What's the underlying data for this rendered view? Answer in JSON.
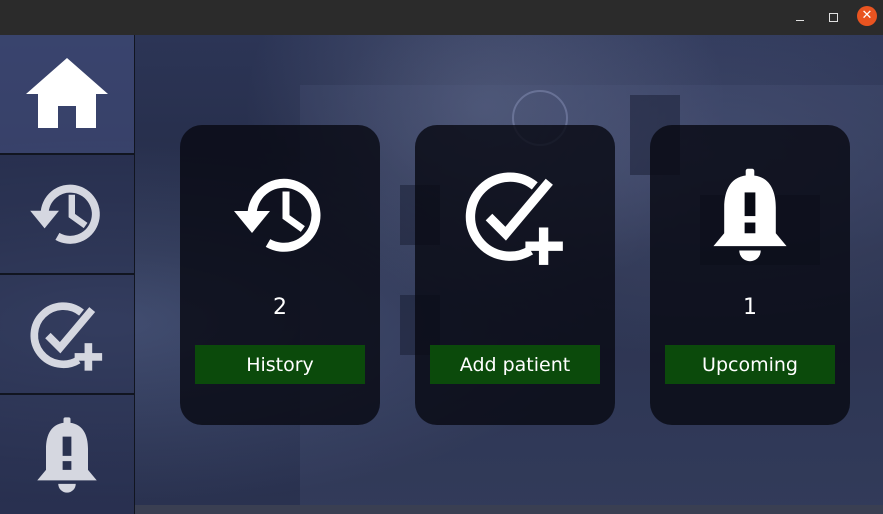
{
  "window": {
    "controls": {
      "minimize_icon": "minimize-icon",
      "maximize_icon": "maximize-icon",
      "close_glyph": "✕"
    },
    "close_color": "#e95420"
  },
  "sidebar": {
    "items": [
      {
        "name": "home",
        "icon": "home-icon",
        "active": true
      },
      {
        "name": "history",
        "icon": "history-icon",
        "active": false
      },
      {
        "name": "add-patient",
        "icon": "check-plus-icon",
        "active": false
      },
      {
        "name": "alerts",
        "icon": "bell-alert-icon",
        "active": false
      }
    ]
  },
  "cards": [
    {
      "icon": "history-icon",
      "count": "2",
      "button_label": "History"
    },
    {
      "icon": "check-plus-icon",
      "count": "",
      "button_label": "Add patient"
    },
    {
      "icon": "bell-alert-icon",
      "count": "1",
      "button_label": "Upcoming"
    }
  ],
  "colors": {
    "button_green": "#0b4a0b",
    "card_bg": "#080a14",
    "icon_white": "#ffffff"
  }
}
